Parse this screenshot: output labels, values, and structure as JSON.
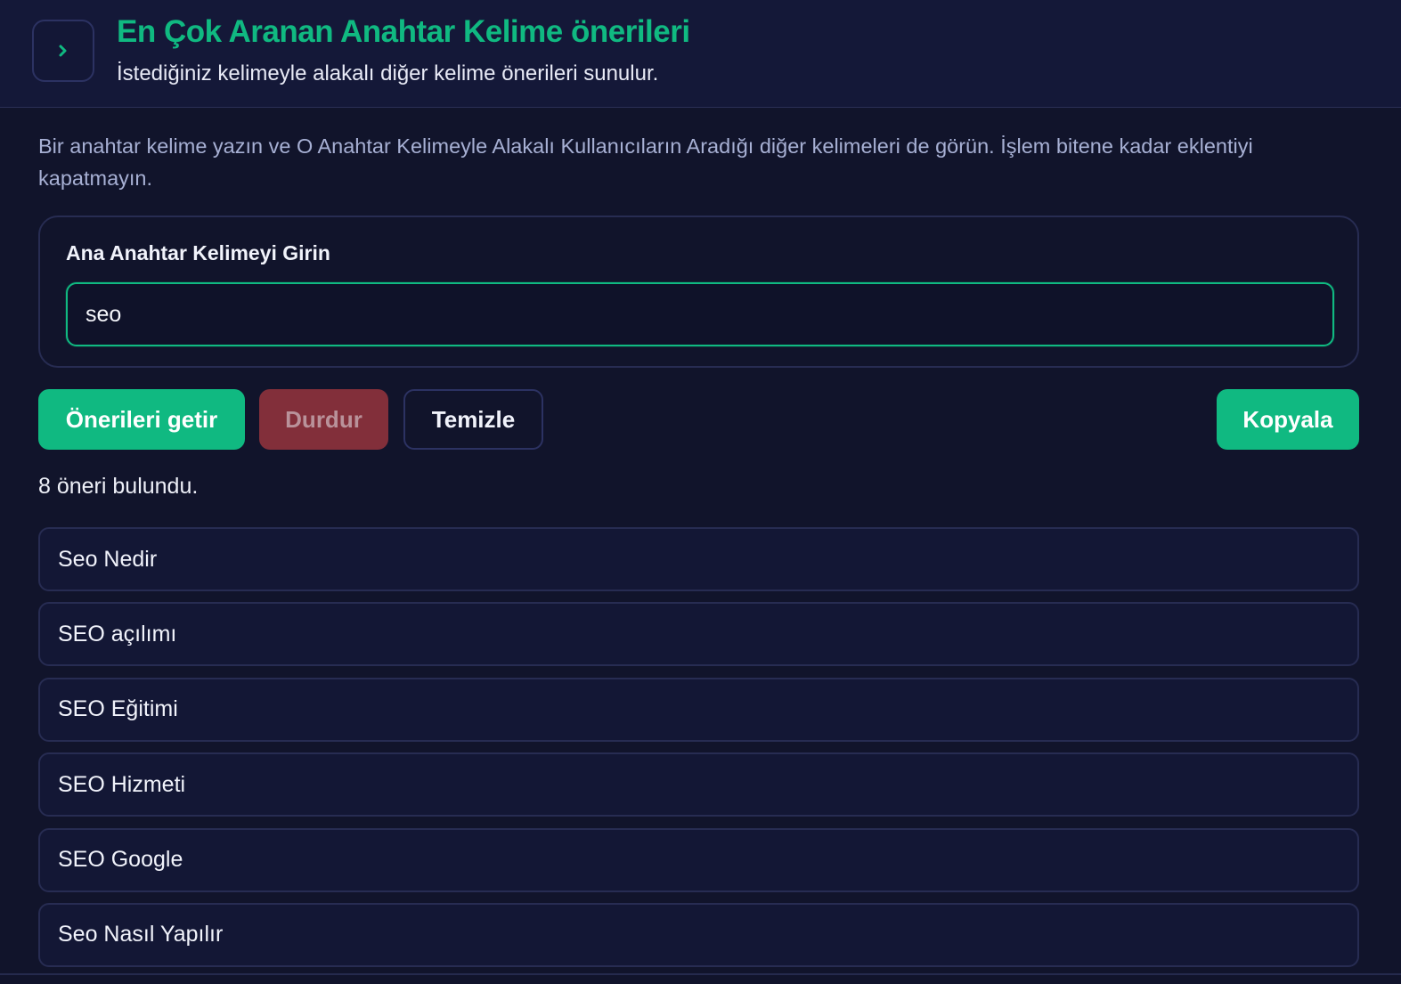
{
  "header": {
    "title": "En Çok Aranan Anahtar Kelime önerileri",
    "subtitle": "İstediğiniz kelimeyle alakalı diğer kelime önerileri sunulur.",
    "toggle_icon": "chevron-right-icon"
  },
  "description": "Bir anahtar kelime yazın ve O Anahtar Kelimeyle Alakalı Kullanıcıların Aradığı diğer kelimeleri de görün. İşlem bitene kadar eklentiyi kapatmayın.",
  "input_section": {
    "label": "Ana Anahtar Kelimeyi Girin",
    "value": "seo"
  },
  "actions": {
    "fetch_label": "Önerileri getir",
    "stop_label": "Durdur",
    "clear_label": "Temizle",
    "copy_label": "Kopyala"
  },
  "results": {
    "count_text": "8 öneri bulundu.",
    "items": [
      "Seo Nedir",
      "SEO açılımı",
      "SEO Eğitimi",
      "SEO Hizmeti",
      "SEO Google",
      "Seo Nasıl Yapılır"
    ]
  },
  "colors": {
    "accent": "#10b981",
    "background": "#11142b",
    "stop": "#822f3a"
  }
}
